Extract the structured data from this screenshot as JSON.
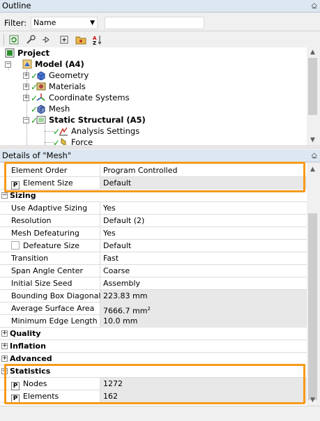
{
  "outline": {
    "title": "Outline",
    "pin_glyph": "⎐",
    "filter_label": "Filter:",
    "filter_value": "Name",
    "filter_text": "",
    "toolbar": [
      "refresh-icon",
      "wrench-icon",
      "tree-collapse-icon",
      "expand-all-icon",
      "folder-icon",
      "sort-az-icon"
    ],
    "tree": [
      {
        "label": "Project",
        "bold": true,
        "icon": "project-icon"
      },
      {
        "label": "Model (A4)",
        "bold": true,
        "icon": "model-icon"
      },
      {
        "label": "Geometry",
        "bold": false,
        "icon": "geometry-icon"
      },
      {
        "label": "Materials",
        "bold": false,
        "icon": "materials-icon"
      },
      {
        "label": "Coordinate Systems",
        "bold": false,
        "icon": "coordinate-systems-icon"
      },
      {
        "label": "Mesh",
        "bold": false,
        "icon": "mesh-icon"
      },
      {
        "label": "Static Structural (A5)",
        "bold": true,
        "icon": "static-structural-icon"
      },
      {
        "label": "Analysis Settings",
        "bold": false,
        "icon": "analysis-settings-icon"
      },
      {
        "label": "Force",
        "bold": false,
        "icon": "force-icon"
      }
    ]
  },
  "details": {
    "title": "Details of \"Mesh\"",
    "defaults": [
      {
        "name": "Element Order",
        "value": "Program Controlled"
      },
      {
        "name": "Element Size",
        "value": "Default",
        "p": "P"
      }
    ],
    "sizing": {
      "label": "Sizing",
      "rows": [
        {
          "name": "Use Adaptive Sizing",
          "value": "Yes"
        },
        {
          "name": "Resolution",
          "value": "Default (2)"
        },
        {
          "name": "Mesh Defeaturing",
          "value": "Yes"
        },
        {
          "name": "Defeature Size",
          "value": "Default"
        },
        {
          "name": "Transition",
          "value": "Fast"
        },
        {
          "name": "Span Angle Center",
          "value": "Coarse"
        },
        {
          "name": "Initial Size Seed",
          "value": "Assembly"
        },
        {
          "name": "Bounding Box Diagonal",
          "value": "223.83 mm"
        },
        {
          "name": "Average Surface Area",
          "value": "7666.7 mm",
          "sup": "2"
        },
        {
          "name": "Minimum Edge Length",
          "value": "10.0 mm"
        }
      ]
    },
    "groups": [
      "Quality",
      "Inflation",
      "Advanced"
    ],
    "statistics": {
      "label": "Statistics",
      "rows": [
        {
          "name": "Nodes",
          "value": "1272",
          "p": "P"
        },
        {
          "name": "Elements",
          "value": "162",
          "p": "P"
        }
      ]
    }
  },
  "colors": {
    "highlight": "#f79a1a",
    "title_bar": "#dde7f1",
    "check": "#109b10"
  }
}
